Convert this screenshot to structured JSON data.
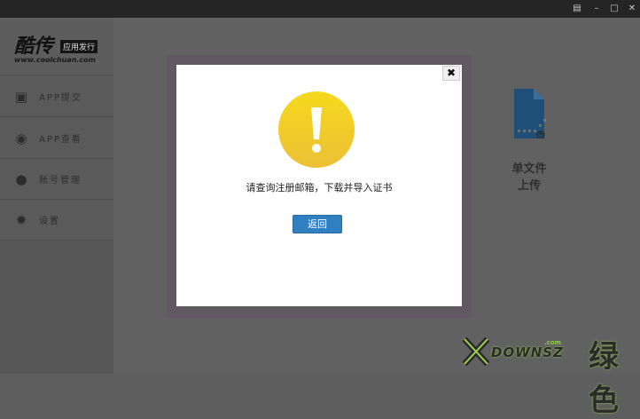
{
  "window": {
    "controls": [
      {
        "name": "chat-icon",
        "glyph": "▤"
      },
      {
        "name": "minimize-icon",
        "glyph": "–"
      },
      {
        "name": "maximize-icon",
        "glyph": "□"
      },
      {
        "name": "close-icon",
        "glyph": "✕"
      }
    ]
  },
  "logo": {
    "name": "酷传",
    "tag": "应用发行",
    "url": "www.coolchuan.com"
  },
  "sidebar": {
    "items": [
      {
        "label": "APP提交",
        "icon": "upload-box-icon",
        "glyph": "▣"
      },
      {
        "label": "APP查看",
        "icon": "eye-icon",
        "glyph": "◉"
      },
      {
        "label": "账号管理",
        "icon": "user-icon",
        "glyph": "●"
      },
      {
        "label": "设置",
        "icon": "gear-icon",
        "glyph": "✹"
      }
    ]
  },
  "main": {
    "upload": {
      "label_line1": "单文件",
      "label_line2": "上传",
      "icon": "file-upload-icon"
    }
  },
  "dialog": {
    "close_glyph": "✖",
    "icon": "exclamation-icon",
    "message": "请查询注册邮箱，下载并导入证书",
    "button_label": "返回"
  },
  "watermark": {
    "brand": "DOWNSZ",
    "domain": ".com",
    "cn": "绿色"
  },
  "colors": {
    "button_blue": "#2f7fc1",
    "alert_yellow": "#f3cf1e",
    "file_blue": "#1f4f77",
    "watermark_green": "#8ed13b"
  }
}
